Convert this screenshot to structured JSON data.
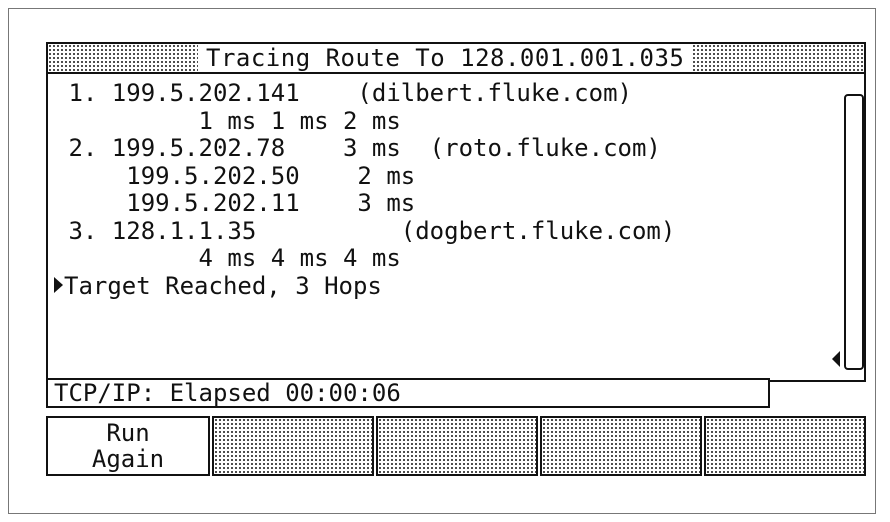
{
  "header": {
    "title": "Tracing Route To 128.001.001.035"
  },
  "trace": {
    "lines": [
      " 1. 199.5.202.141    (dilbert.fluke.com)",
      "          1 ms 1 ms 2 ms",
      " 2. 199.5.202.78    3 ms  (roto.fluke.com)",
      "     199.5.202.50    2 ms",
      "     199.5.202.11    3 ms",
      " 3. 128.1.1.35          (dogbert.fluke.com)",
      "          4 ms 4 ms 4 ms"
    ],
    "result": "Target Reached, 3 Hops"
  },
  "status": {
    "text": "TCP/IP: Elapsed 00:00:06"
  },
  "softkeys": [
    {
      "label": "Run\nAgain",
      "enabled": true
    },
    {
      "label": "",
      "enabled": false
    },
    {
      "label": "",
      "enabled": false
    },
    {
      "label": "",
      "enabled": false
    },
    {
      "label": "",
      "enabled": false
    }
  ],
  "icons": {
    "result_marker": "right-triangle-icon",
    "scroll_marker": "left-triangle-icon"
  }
}
